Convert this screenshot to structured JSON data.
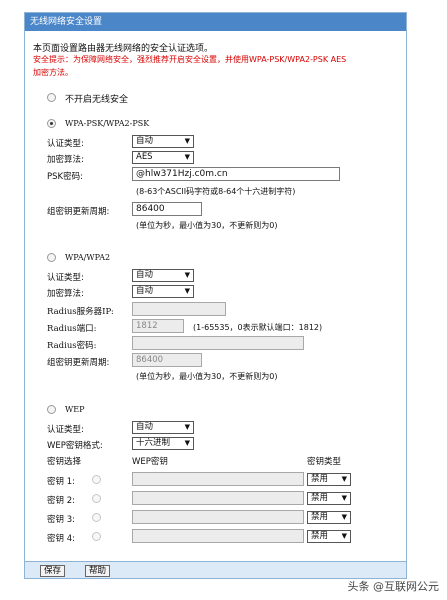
{
  "title": "无线网络安全设置",
  "intro": "本页面设置路由器无线网络的安全认证选项。",
  "warning_line1": "安全提示：为保障网络安全，强烈推荐开启安全设置，并使用WPA-PSK/WPA2-PSK AES",
  "warning_line2": "加密方法。",
  "no_security_label": "不开启无线安全",
  "wpa_psk": {
    "section_label": "WPA-PSK/WPA2-PSK",
    "auth_label": "认证类型:",
    "auth_value": "自动",
    "enc_label": "加密算法:",
    "enc_value": "AES",
    "psk_label": "PSK密码:",
    "psk_value": "@hlw371Hzj.c0m.cn",
    "psk_hint": "(8-63个ASCII码字符或8-64个十六进制字符)",
    "renew_label": "组密钥更新周期:",
    "renew_value": "86400",
    "renew_hint": "(单位为秒，最小值为30，不更新则为0)"
  },
  "wpa": {
    "section_label": "WPA/WPA2",
    "auth_label": "认证类型:",
    "auth_value": "自动",
    "enc_label": "加密算法:",
    "enc_value": "自动",
    "radius_ip_label": "Radius服务器IP:",
    "radius_ip_value": "",
    "radius_port_label": "Radius端口:",
    "radius_port_value": "1812",
    "radius_port_hint": "(1-65535，0表示默认端口：1812)",
    "radius_pwd_label": "Radius密码:",
    "radius_pwd_value": "",
    "renew_label": "组密钥更新周期:",
    "renew_value": "86400",
    "renew_hint": "(单位为秒，最小值为30，不更新则为0)"
  },
  "wep": {
    "section_label": "WEP",
    "auth_label": "认证类型:",
    "auth_value": "自动",
    "format_label": "WEP密钥格式:",
    "format_value": "十六进制",
    "col_select": "密钥选择",
    "col_key": "WEP密钥",
    "col_type": "密钥类型",
    "keys": [
      {
        "label": "密钥 1:",
        "value": "",
        "type": "禁用"
      },
      {
        "label": "密钥 2:",
        "value": "",
        "type": "禁用"
      },
      {
        "label": "密钥 3:",
        "value": "",
        "type": "禁用"
      },
      {
        "label": "密钥 4:",
        "value": "",
        "type": "禁用"
      }
    ]
  },
  "buttons": {
    "save": "保存",
    "help": "帮助"
  },
  "watermark": "头条 @互联网公元",
  "dropdown_arrow": "▼",
  "colors": {
    "titlebar": "#4a86c8",
    "warning": "#d60000",
    "footer": "#dce9f6"
  }
}
